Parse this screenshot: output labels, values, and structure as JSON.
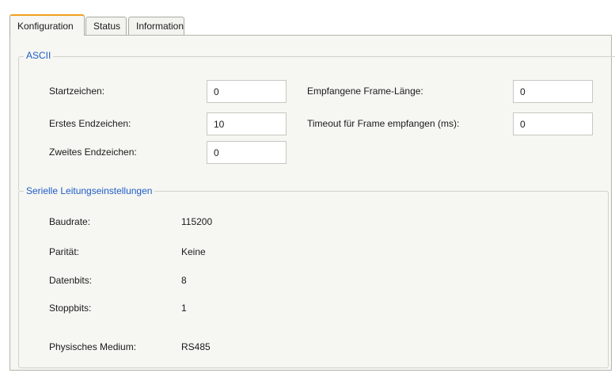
{
  "tabs": [
    {
      "label": "Konfiguration",
      "active": true
    },
    {
      "label": "Status",
      "active": false
    },
    {
      "label": "Information",
      "active": false
    }
  ],
  "ascii": {
    "title": "ASCII",
    "fields": [
      {
        "label": "Startzeichen:",
        "value": "0"
      },
      {
        "label": "Erstes Endzeichen:",
        "value": "10"
      },
      {
        "label": "Zweites Endzeichen:",
        "value": "0"
      },
      {
        "label": "Empfangene Frame-Länge:",
        "value": "0"
      },
      {
        "label": "Timeout für Frame empfangen (ms):",
        "value": "0"
      }
    ]
  },
  "serial": {
    "title": "Serielle Leitungseinstellungen",
    "rows": [
      {
        "label": "Baudrate:",
        "value": "115200"
      },
      {
        "label": "Parität:",
        "value": "Keine"
      },
      {
        "label": "Datenbits:",
        "value": "8"
      },
      {
        "label": "Stoppbits:",
        "value": "1"
      },
      {
        "label": "Physisches Medium:",
        "value": "RS485"
      }
    ]
  },
  "colors": {
    "accent_tab": "#f0a020",
    "group_title": "#1e5dc8",
    "panel_bg": "#f6f6f2"
  }
}
